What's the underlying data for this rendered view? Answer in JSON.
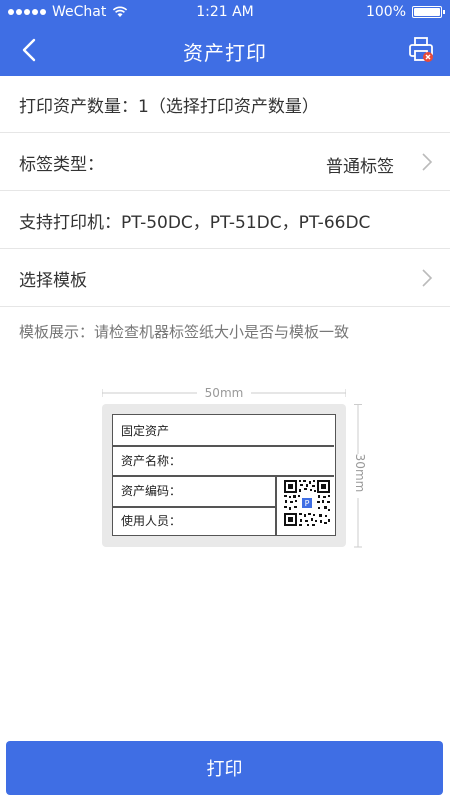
{
  "status": {
    "carrier": "WeChat",
    "time": "1:21 AM",
    "battery": "100%"
  },
  "nav": {
    "title": "资产打印",
    "back_icon": "chevron-left-icon",
    "printer_icon": "printer-icon"
  },
  "rows": {
    "quantity": "打印资产数量：1（选择打印资产数量）",
    "label_type": {
      "label": "标签类型：",
      "value": "普通标签"
    },
    "printers": "支持打印机：PT-50DC，PT-51DC，PT-66DC",
    "template": "选择模板"
  },
  "hint": "模板展示：请检查机器标签纸大小是否与模板一致",
  "preview": {
    "width_label": "50mm",
    "height_label": "30mm",
    "rows": [
      "固定资产",
      "资产名称：",
      "资产编码：",
      "使用人员："
    ]
  },
  "print_button": "打印",
  "colors": {
    "primary": "#3f6ee4",
    "badge": "#e84a3a"
  }
}
